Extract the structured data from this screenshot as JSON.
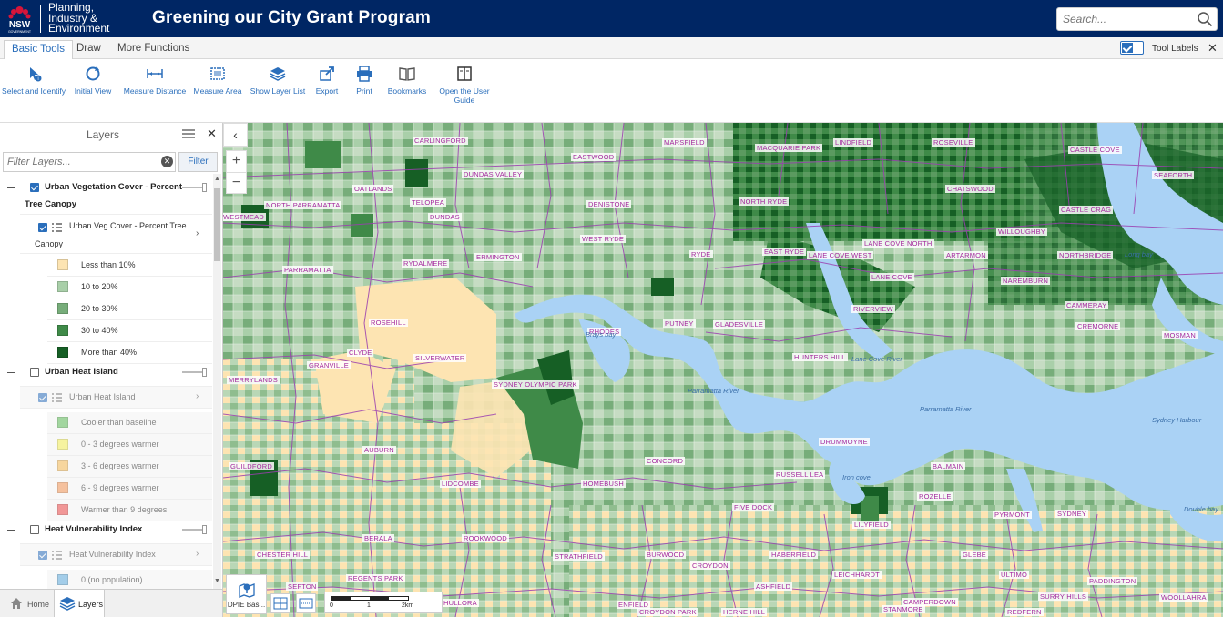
{
  "header": {
    "brand_lines": [
      "Planning,",
      "Industry &",
      "Environment"
    ],
    "logo_text": "NSW",
    "logo_subtext": "GOVERNMENT",
    "app_title": "Greening our City Grant Program",
    "search_placeholder": "Search..."
  },
  "tabs": [
    {
      "label": "Basic Tools",
      "active": true
    },
    {
      "label": "Draw",
      "active": false
    },
    {
      "label": "More Functions",
      "active": false
    }
  ],
  "tool_labels": {
    "label": "Tool Labels",
    "enabled": true
  },
  "toolbar": [
    {
      "label": "Select and Identify",
      "icon": "identify-icon"
    },
    {
      "label": "Initial View",
      "icon": "refresh-icon"
    },
    {
      "label": "Measure Distance",
      "icon": "measure-distance-icon"
    },
    {
      "label": "Measure Area",
      "icon": "measure-area-icon"
    },
    {
      "label": "Show Layer List",
      "icon": "layers-icon"
    },
    {
      "label": "Export",
      "icon": "export-icon"
    },
    {
      "label": "Print",
      "icon": "print-icon"
    },
    {
      "label": "Bookmarks",
      "icon": "bookmarks-icon"
    },
    {
      "label": "Open the User Guide",
      "icon": "user-guide-icon"
    }
  ],
  "layers_panel": {
    "title": "Layers",
    "filter_placeholder": "Filter Layers...",
    "filter_button": "Filter",
    "groups": [
      {
        "label_line1": "Urban Vegetation Cover - Percent",
        "label_line2": "Tree Canopy",
        "checked": true,
        "sublayer": {
          "label_line1": "Urban Veg Cover - Percent Tree",
          "label_line2": "Canopy",
          "checked": true
        },
        "legend": [
          {
            "label": "Less than 10%",
            "color": "#fde4b2"
          },
          {
            "label": "10 to 20%",
            "color": "#a9cfa9"
          },
          {
            "label": "20 to 30%",
            "color": "#77ad7a"
          },
          {
            "label": "30 to 40%",
            "color": "#3f8a48"
          },
          {
            "label": "More than 40%",
            "color": "#165f25"
          }
        ]
      },
      {
        "label_line1": "Urban Heat Island",
        "checked": false,
        "sublayer": {
          "label_line1": "Urban Heat Island",
          "checked": true
        },
        "legend": [
          {
            "label": "Cooler than baseline",
            "color": "#7fc97a"
          },
          {
            "label": "0 - 3 degrees warmer",
            "color": "#f6f27a"
          },
          {
            "label": "3 - 6 degrees warmer",
            "color": "#f7c979"
          },
          {
            "label": "6 - 9 degrees warmer",
            "color": "#f5ab78"
          },
          {
            "label": "Warmer than 9 degrees",
            "color": "#ef6f6f"
          }
        ]
      },
      {
        "label_line1": "Heat Vulnerability Index",
        "checked": false,
        "sublayer": {
          "label_line1": "Heat Vulnerability Index",
          "checked": true
        },
        "legend": [
          {
            "label": "0 (no population)",
            "color": "#8fc3e6"
          }
        ]
      }
    ]
  },
  "bottom_tabs": [
    {
      "label": "Home",
      "active": false
    },
    {
      "label": "Layers",
      "active": true
    }
  ],
  "map": {
    "basemap_label": "DPIE Bas...",
    "scale_labels": [
      "0",
      "1",
      "2km"
    ],
    "suburbs": [
      "CARLINGFORD",
      "MARSFIELD",
      "MACQUARIE PARK",
      "LINDFIELD",
      "ROSEVILLE",
      "CASTLE COVE",
      "EASTWOOD",
      "SEAFORTH",
      "TELOPEA",
      "DUNDAS VALLEY",
      "CHATSWOOD",
      "OATLANDS",
      "NORTH PARRAMATTA",
      "DENISTONE",
      "NORTH RYDE",
      "CASTLE CRAG",
      "WESTMEAD",
      "DUNDAS",
      "WEST RYDE",
      "WILLOUGHBY",
      "LANE COVE NORTH",
      "EAST RYDE",
      "LANE COVE WEST",
      "ARTARMON",
      "RYDE",
      "NORTHBRIDGE",
      "ERMINGTON",
      "RYDALMERE",
      "PARRAMATTA",
      "LANE COVE",
      "NAREMBURN",
      "CAMMERAY",
      "RIVERVIEW",
      "PUTNEY",
      "GLADESVILLE",
      "CREMORNE",
      "ROSEHILL",
      "RHODES",
      "MOSMAN",
      "CLYDE",
      "HUNTERS HILL",
      "SILVERWATER",
      "GRANVILLE",
      "MERRYLANDS",
      "SYDNEY OLYMPIC PARK",
      "DRUMMOYNE",
      "AUBURN",
      "CONCORD",
      "BALMAIN",
      "GUILDFORD",
      "RUSSELL LEA",
      "LIDCOMBE",
      "HOMEBUSH",
      "ROZELLE",
      "FIVE DOCK",
      "LILYFIELD",
      "PYRMONT",
      "SYDNEY",
      "BERALA",
      "ROOKWOOD",
      "CHESTER HILL",
      "STRATHFIELD",
      "BURWOOD",
      "HABERFIELD",
      "GLEBE",
      "CROYDON",
      "REGENTS PARK",
      "ULTIMO",
      "LEICHHARDT",
      "PADDINGTON",
      "SEFTON",
      "ASHFIELD",
      "SURRY HILLS",
      "WOOLLAHRA",
      "ENFIELD",
      "HULLORA",
      "CAMPERDOWN",
      "STANMORE",
      "REDFERN",
      "CROYDON PARK",
      "HERNE HILL"
    ],
    "water_labels": [
      "Brays bay",
      "Parramatta River",
      "Lane Cove River",
      "Parramatta River",
      "Iron cove",
      "Sydney Harbour",
      "Long bay",
      "Double bay"
    ]
  }
}
